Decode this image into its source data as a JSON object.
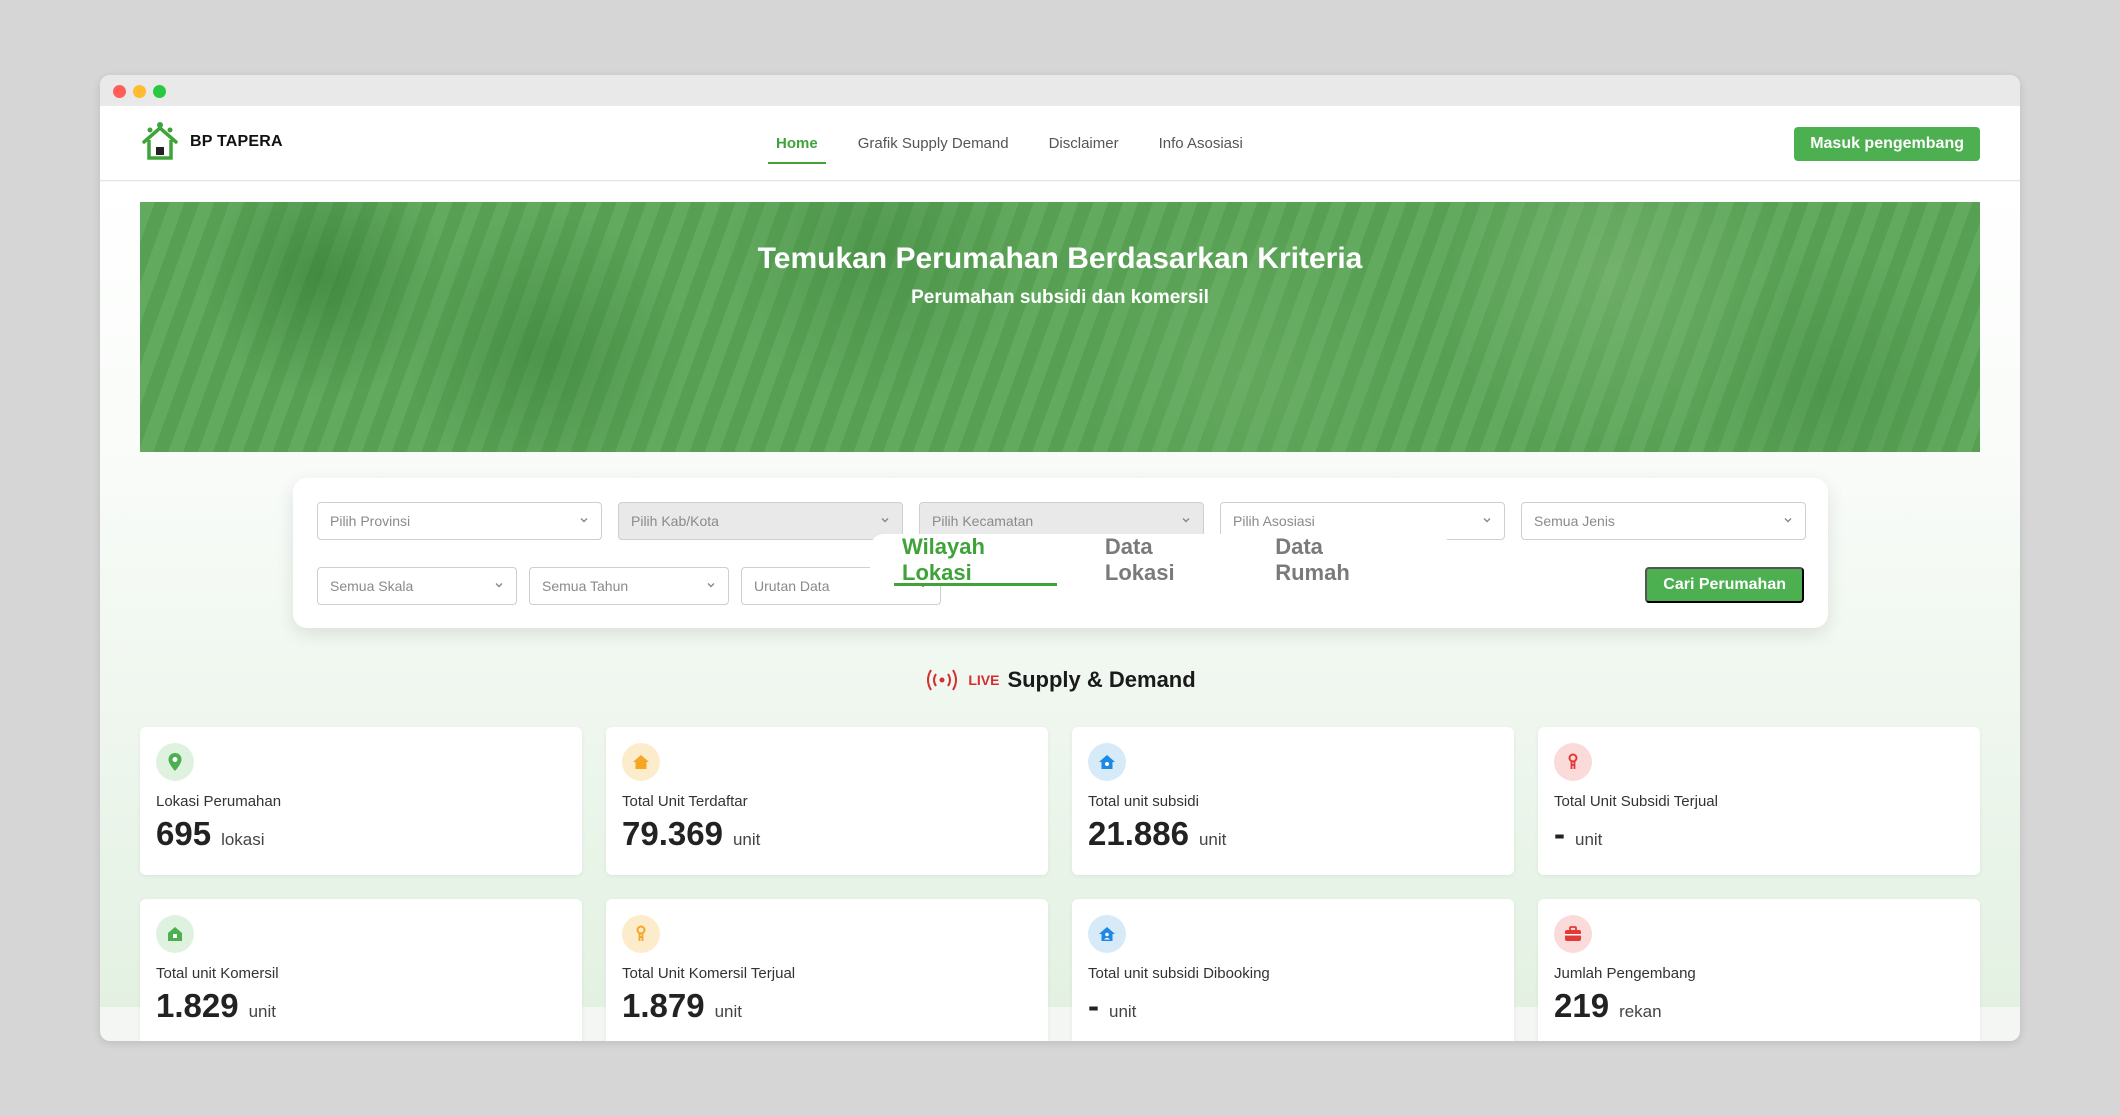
{
  "brand": {
    "name": "BP TAPERA"
  },
  "nav": {
    "links": [
      "Home",
      "Grafik Supply Demand",
      "Disclaimer",
      "Info Asosiasi"
    ],
    "cta": "Masuk pengembang"
  },
  "hero": {
    "title": "Temukan Perumahan Berdasarkan Kriteria",
    "subtitle": "Perumahan subsidi dan komersil"
  },
  "tabs": [
    "Wilayah Lokasi",
    "Data Lokasi",
    "Data Rumah"
  ],
  "filters": {
    "provinsi": "Pilih Provinsi",
    "kabkota": "Pilih Kab/Kota",
    "kecamatan": "Pilih Kecamatan",
    "asosiasi": "Pilih Asosiasi",
    "jenis": "Semua Jenis",
    "skala": "Semua Skala",
    "tahun": "Semua Tahun",
    "urutan": "Urutan Data",
    "search_button": "Cari Perumahan"
  },
  "live": {
    "badge": "LIVE",
    "title": "Supply & Demand"
  },
  "colors": {
    "accent": "#4caf50",
    "live": "#d32f2f"
  },
  "stats": [
    {
      "label": "Lokasi Perumahan",
      "value": "695",
      "unit": "lokasi",
      "icon": "map-pin-icon"
    },
    {
      "label": "Total Unit Terdaftar",
      "value": "79.369",
      "unit": "unit",
      "icon": "house-icon"
    },
    {
      "label": "Total unit subsidi",
      "value": "21.886",
      "unit": "unit",
      "icon": "house-star-icon"
    },
    {
      "label": "Total Unit Subsidi Terjual",
      "value": "-",
      "unit": "unit",
      "icon": "key-icon"
    },
    {
      "label": "Total unit Komersil",
      "value": "1.829",
      "unit": "unit",
      "icon": "home-building-icon"
    },
    {
      "label": "Total Unit Komersil Terjual",
      "value": "1.879",
      "unit": "unit",
      "icon": "key-icon"
    },
    {
      "label": "Total unit subsidi Dibooking",
      "value": "-",
      "unit": "unit",
      "icon": "house-user-icon"
    },
    {
      "label": "Jumlah Pengembang",
      "value": "219",
      "unit": "rekan",
      "icon": "briefcase-icon"
    }
  ]
}
